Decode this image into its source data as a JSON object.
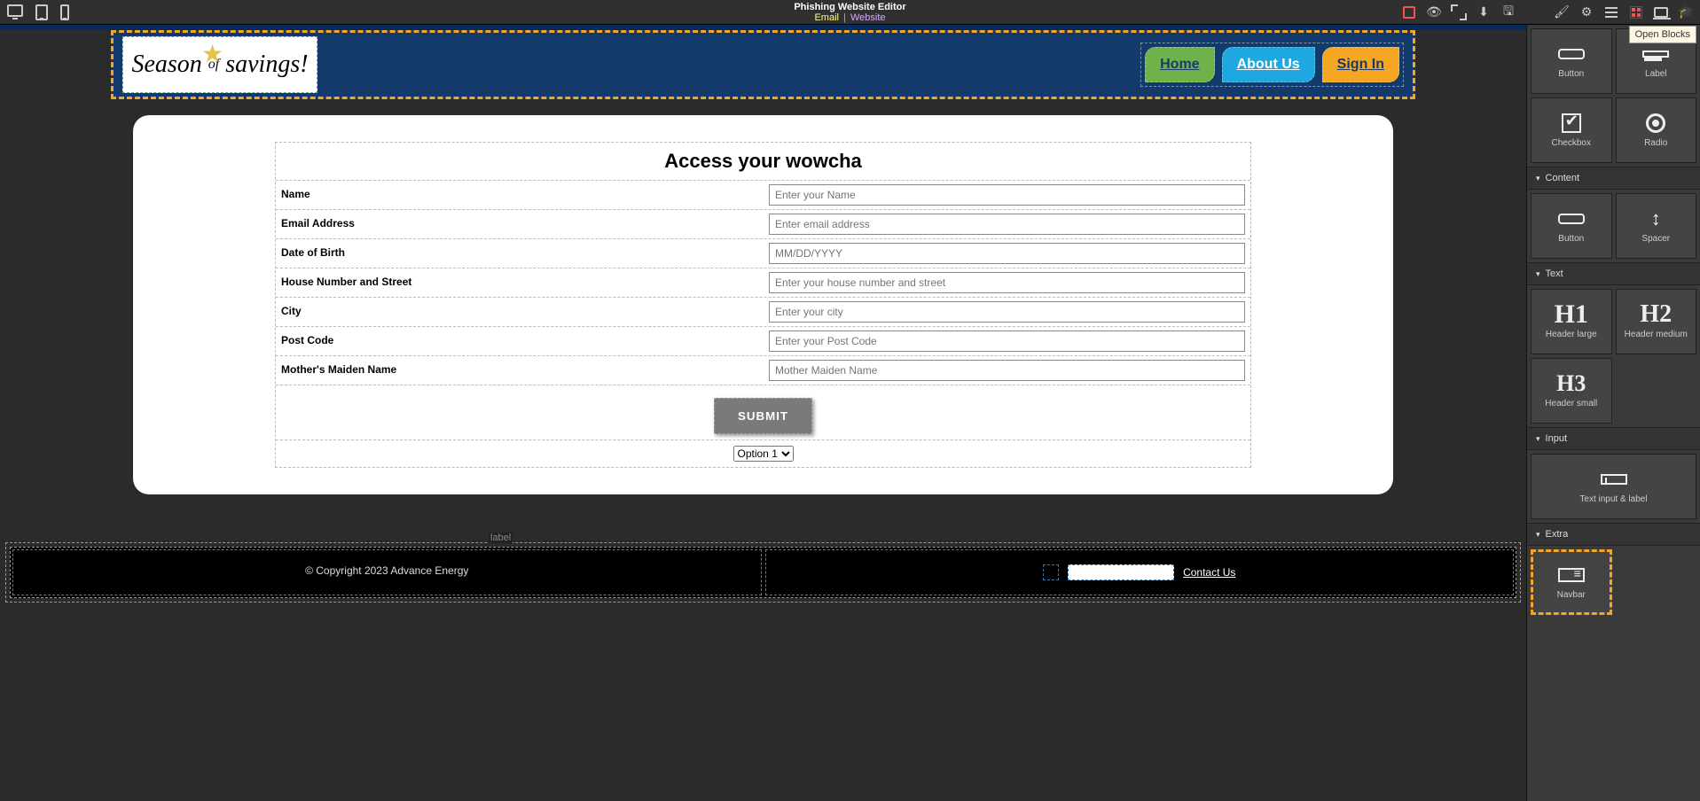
{
  "header": {
    "title": "Phishing Website Editor",
    "email_label": "Email",
    "website_label": "Website",
    "tooltip": "Open Blocks"
  },
  "navbar": {
    "logo_line1": "Season",
    "logo_of": "of",
    "logo_line2": "savings!",
    "home": "Home",
    "about": "About Us",
    "signin": "Sign In"
  },
  "form": {
    "title": "Access your wowcha",
    "name_label": "Name",
    "name_ph": "Enter your Name",
    "email_label": "Email Address",
    "email_ph": "Enter email address",
    "dob_label": "Date of Birth",
    "dob_ph": "MM/DD/YYYY",
    "street_label": "House Number and Street",
    "street_ph": "Enter your house number and street",
    "city_label": "City",
    "city_ph": "Enter your city",
    "post_label": "Post Code",
    "post_ph": "Enter your Post Code",
    "maiden_label": "Mother's Maiden Name",
    "maiden_ph": "Mother Maiden Name",
    "submit": "SUBMIT",
    "option": "Option 1"
  },
  "footer": {
    "label_tag": "label",
    "copyright": "© Copyright 2023 Advance Energy",
    "contact": "Contact Us"
  },
  "panel": {
    "button": "Button",
    "label": "Label",
    "checkbox": "Checkbox",
    "radio": "Radio",
    "content": "Content",
    "spacer": "Spacer",
    "text": "Text",
    "h1": "Header large",
    "h2": "Header medium",
    "h3": "Header small",
    "input": "Input",
    "text_input_label": "Text input & label",
    "extra": "Extra",
    "navbar": "Navbar"
  }
}
